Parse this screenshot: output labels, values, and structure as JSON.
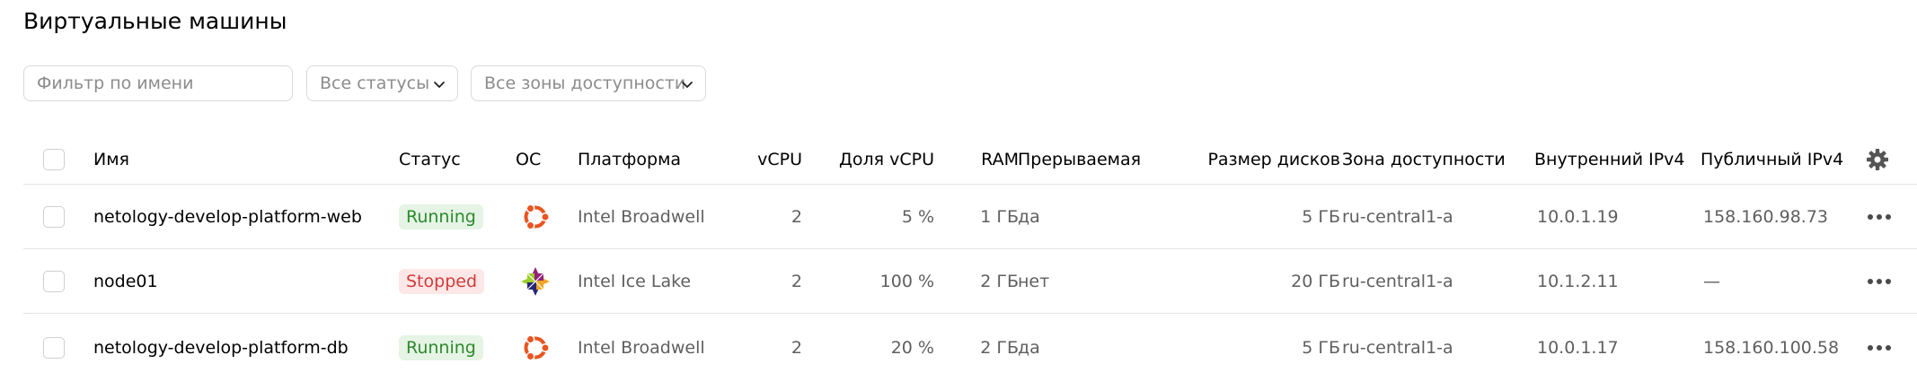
{
  "page": {
    "title": "Виртуальные машины"
  },
  "filters": {
    "name_placeholder": "Фильтр по имени",
    "status_select": "Все статусы",
    "zone_select": "Все зоны доступности"
  },
  "table": {
    "columns": [
      "Имя",
      "Статус",
      "ОС",
      "Платформа",
      "vCPU",
      "Доля vCPU",
      "RAM",
      "Прерываемая",
      "Размер дисков",
      "Зона доступности",
      "Внутренний IPv4",
      "Публичный IPv4"
    ],
    "settings_icon": "gear-icon",
    "rows": [
      {
        "name": "netology-develop-platform-web",
        "status": "Running",
        "status_kind": "running",
        "os_icon": "ubuntu-icon",
        "platform": "Intel Broadwell",
        "vcpu": "2",
        "vcpu_share": "5 %",
        "ram": "1 ГБ",
        "preemptible": "да",
        "disk_size": "5 ГБ",
        "zone": "ru-central1-a",
        "internal_ip": "10.0.1.19",
        "public_ip": "158.160.98.73"
      },
      {
        "name": "node01",
        "status": "Stopped",
        "status_kind": "stopped",
        "os_icon": "centos-icon",
        "platform": "Intel Ice Lake",
        "vcpu": "2",
        "vcpu_share": "100 %",
        "ram": "2 ГБ",
        "preemptible": "нет",
        "disk_size": "20 ГБ",
        "zone": "ru-central1-a",
        "internal_ip": "10.1.2.11",
        "public_ip": "—"
      },
      {
        "name": "netology-develop-platform-db",
        "status": "Running",
        "status_kind": "running",
        "os_icon": "ubuntu-icon",
        "platform": "Intel Broadwell",
        "vcpu": "2",
        "vcpu_share": "20 %",
        "ram": "2 ГБ",
        "preemptible": "да",
        "disk_size": "5 ГБ",
        "zone": "ru-central1-a",
        "internal_ip": "10.0.1.17",
        "public_ip": "158.160.100.58"
      }
    ]
  },
  "colors": {
    "running_bg": "#e5f4e5",
    "running_text": "#2c8a2c",
    "stopped_bg": "#fde7e7",
    "stopped_text": "#d43b3b",
    "ubuntu_orange": "#e95420"
  }
}
